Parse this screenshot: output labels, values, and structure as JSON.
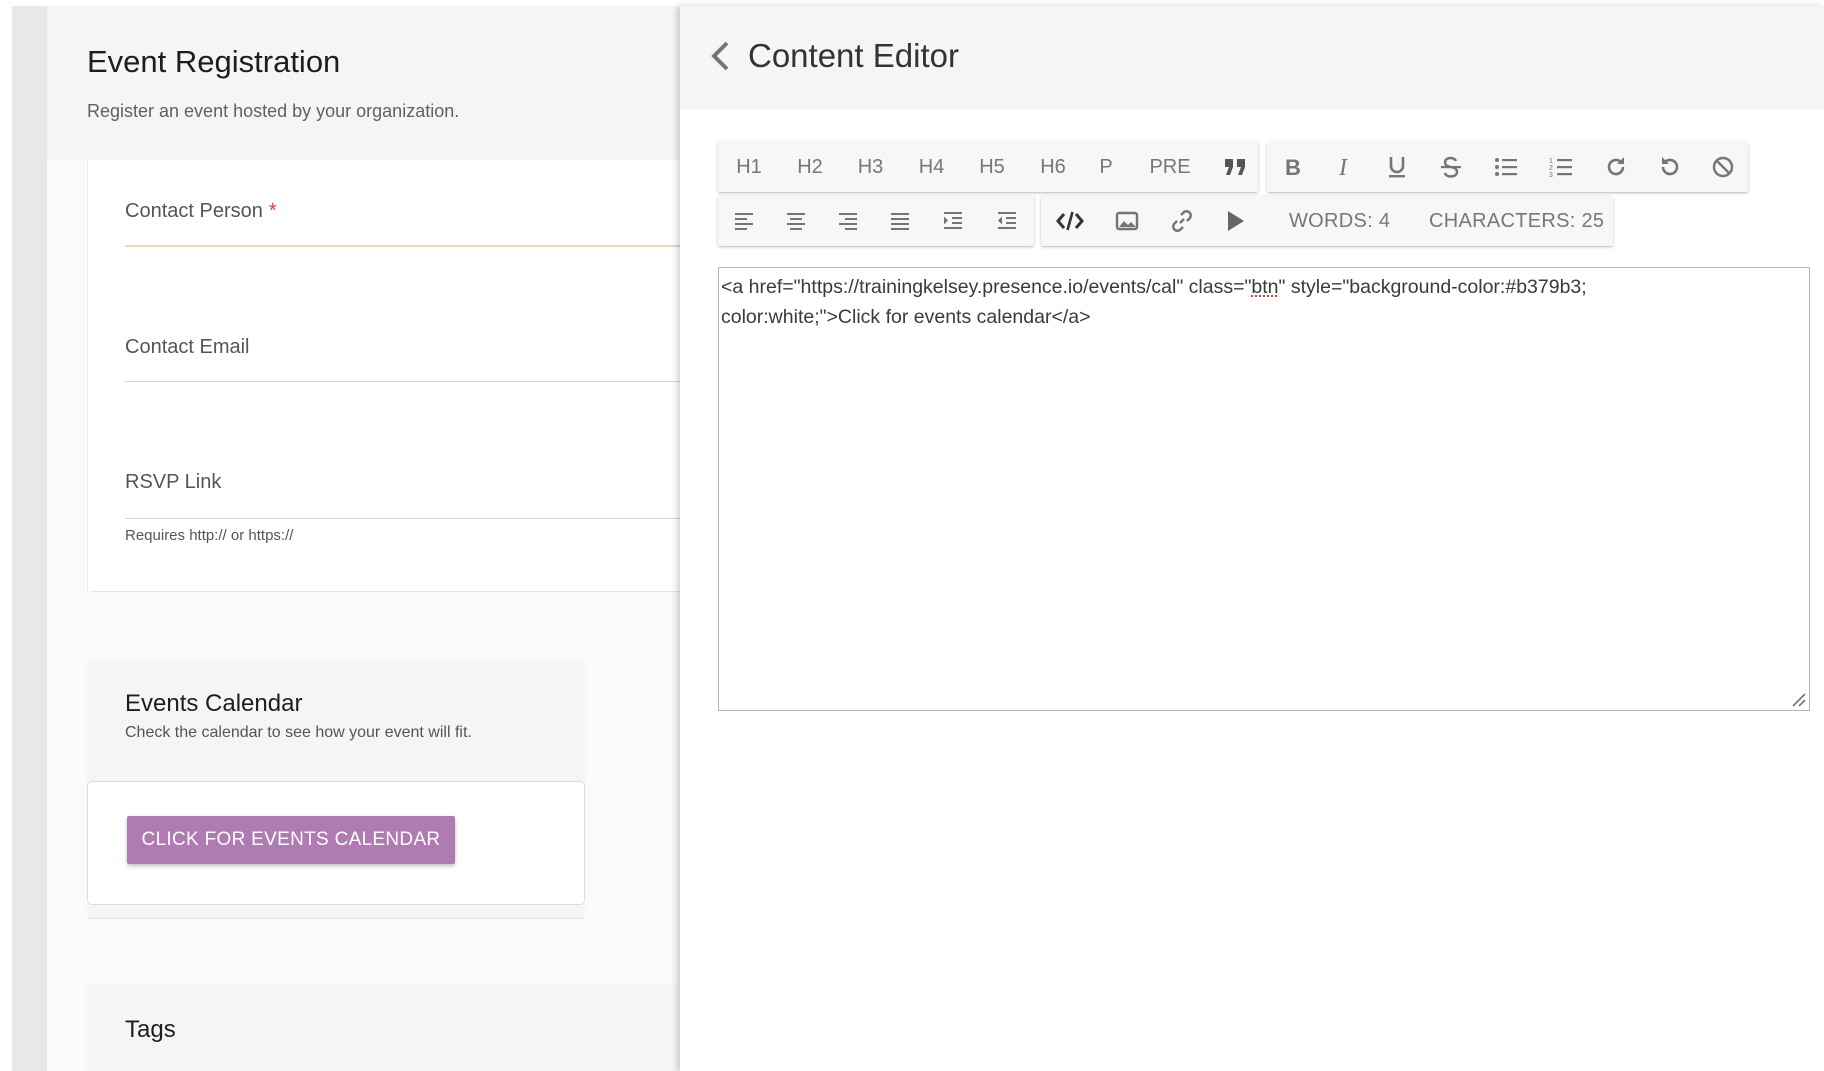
{
  "form": {
    "title": "Event Registration",
    "subtitle": "Register an event hosted by your organization.",
    "fields": {
      "contact_person": "Contact Person",
      "required_mark": "*",
      "contact_email": "Contact Email",
      "rsvp_link": "RSVP Link",
      "rsvp_hint": "Requires http:// or https://"
    },
    "events_calendar": {
      "title": "Events Calendar",
      "description": "Check the calendar to see how your event will fit.",
      "button_label": "CLICK FOR EVENTS CALENDAR",
      "button_color": "#b07ab2"
    },
    "tags": {
      "title": "Tags"
    }
  },
  "editor": {
    "title": "Content Editor",
    "toolbar": {
      "headings": [
        "H1",
        "H2",
        "H3",
        "H4",
        "H5",
        "H6",
        "P",
        "PRE"
      ],
      "icons_row1": [
        "quote-icon",
        "bold-icon",
        "italic-icon",
        "underline-icon",
        "strikethrough-icon",
        "bullet-list-icon",
        "numbered-list-icon",
        "redo-icon",
        "undo-icon",
        "clear-format-icon"
      ],
      "icons_row2": [
        "align-left-icon",
        "align-center-icon",
        "align-right-icon",
        "align-justify-icon",
        "indent-icon",
        "outdent-icon",
        "code-view-icon",
        "image-icon",
        "link-icon",
        "video-icon"
      ],
      "words": "WORDS: 4",
      "characters": "CHARACTERS: 25"
    },
    "code": {
      "line1_before": "<a href=\"https://trainingkelsey.presence.io/events/cal\" class=\"",
      "line1_misspelled": "btn",
      "line1_after": "\" style=\"background-color:#b379b3;",
      "line2": "color:white;\">Click for events calendar</a>"
    }
  }
}
